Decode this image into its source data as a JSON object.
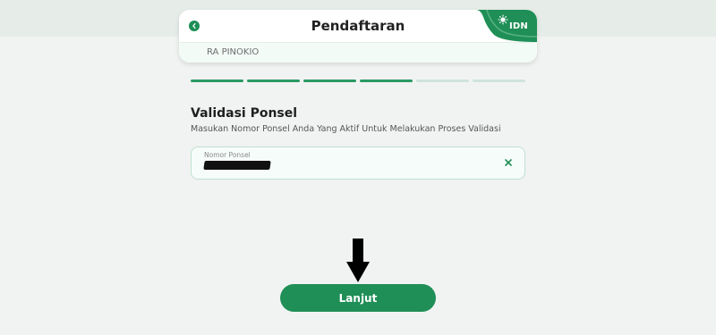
{
  "header": {
    "title": "Pendaftaran",
    "school_name": "RA PINOKIO",
    "logo_text": "IDN",
    "back_icon": "chevron-left-icon"
  },
  "progress": {
    "total_steps": 6,
    "completed_steps": 4
  },
  "section": {
    "title": "Validasi Ponsel",
    "subtitle": "Masukan Nomor Ponsel Anda Yang Aktif Untuk Melakukan Proses Validasi"
  },
  "phone_field": {
    "label": "Nomor Ponsel",
    "clear_icon": "close-icon"
  },
  "annotation": {
    "icon": "arrow-down-icon"
  },
  "actions": {
    "continue_label": "Lanjut"
  },
  "colors": {
    "primary": "#1f8f57",
    "progress_done": "#2a9a63",
    "progress_pending": "#cfe4da",
    "background": "#f1f3f2"
  }
}
